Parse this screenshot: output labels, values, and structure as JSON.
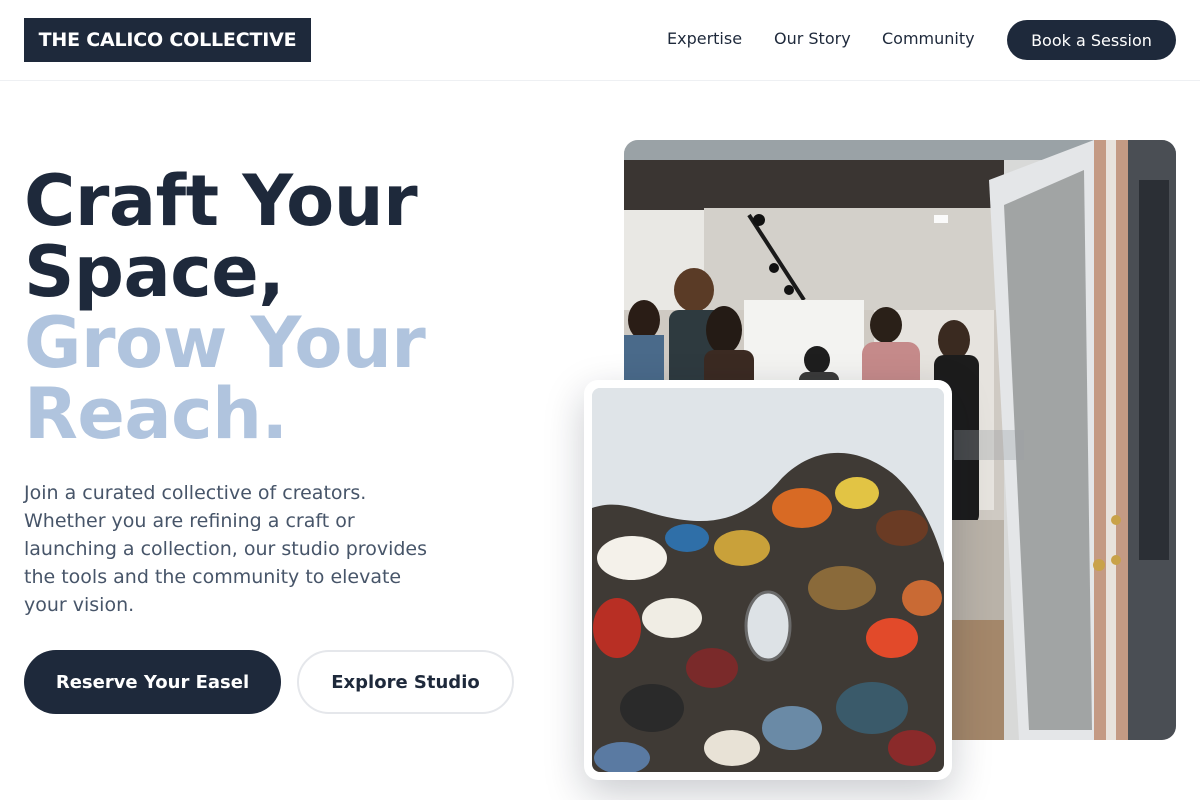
{
  "header": {
    "logo": "THE CALICO COLLECTIVE",
    "nav": [
      {
        "label": "Expertise"
      },
      {
        "label": "Our Story"
      },
      {
        "label": "Community"
      }
    ],
    "cta_label": "Book a Session"
  },
  "hero": {
    "headline_line1": "Craft Your",
    "headline_line2": "Space,",
    "headline_line3": "Grow Your",
    "headline_line4": "Reach.",
    "intro_lines": [
      "Join a curated collective of creators.",
      "Whether you are refining a craft or",
      "launching a collection, our studio provides",
      "the tools and the community to elevate",
      "your vision."
    ],
    "primary_button": "Reserve Your Easel",
    "secondary_button": "Explore Studio"
  },
  "images": {
    "gallery_photo": "gallery-opening-photo",
    "palette_photo": "paint-palette-photo"
  },
  "colors": {
    "navy": "#1e293b",
    "accent_light_blue": "#b0c4de",
    "body_text": "#475569"
  }
}
